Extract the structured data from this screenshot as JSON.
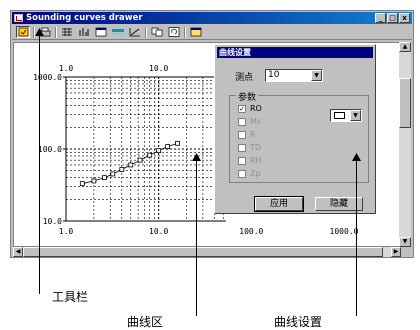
{
  "window": {
    "title": "Sounding curves  drawer",
    "buttons": {
      "minimize": "_",
      "maximize": "□",
      "close": "x"
    }
  },
  "toolbar": {
    "icons": [
      "options-icon",
      "print-icon",
      "layout-icon",
      "bar-icon",
      "window-icon",
      "grid-icon",
      "axis-icon",
      "copy-icon",
      "refresh-icon",
      "dialog-icon"
    ]
  },
  "chart_data": {
    "type": "scatter",
    "x_top_ticks": [
      "1.0",
      "10.0"
    ],
    "x_bottom_ticks": [
      "1.0",
      "10.0",
      "100.0",
      "1000.0"
    ],
    "y_ticks": [
      "1000.0",
      "100.0",
      "10.0"
    ],
    "x_scale": "log",
    "y_scale": "log",
    "xlim": [
      1,
      1000
    ],
    "ylim": [
      10,
      1000
    ],
    "series": [
      {
        "x": [
          1.5,
          2.0,
          2.6,
          3.2,
          4.0,
          5.0,
          6.3,
          8.0,
          10.0,
          12.5,
          16.0
        ],
        "y": [
          33,
          36,
          40,
          45,
          52,
          60,
          70,
          82,
          95,
          108,
          120
        ]
      }
    ]
  },
  "dialog": {
    "title": "曲线设置",
    "point_label": "测点",
    "point_value": "10",
    "params_label": "参数",
    "params": [
      {
        "label": "RO",
        "checked": true,
        "enabled": true
      },
      {
        "label": "Ms",
        "checked": false,
        "enabled": false
      },
      {
        "label": "R",
        "checked": false,
        "enabled": false
      },
      {
        "label": "TD",
        "checked": false,
        "enabled": false
      },
      {
        "label": "RH",
        "checked": false,
        "enabled": false
      },
      {
        "label": "Zp",
        "checked": false,
        "enabled": false
      }
    ],
    "apply_button": "应用",
    "hide_button": "隐藏"
  },
  "captions": {
    "toolbar": "工具栏",
    "curve_area": "曲线区",
    "curve_settings": "曲线设置"
  }
}
